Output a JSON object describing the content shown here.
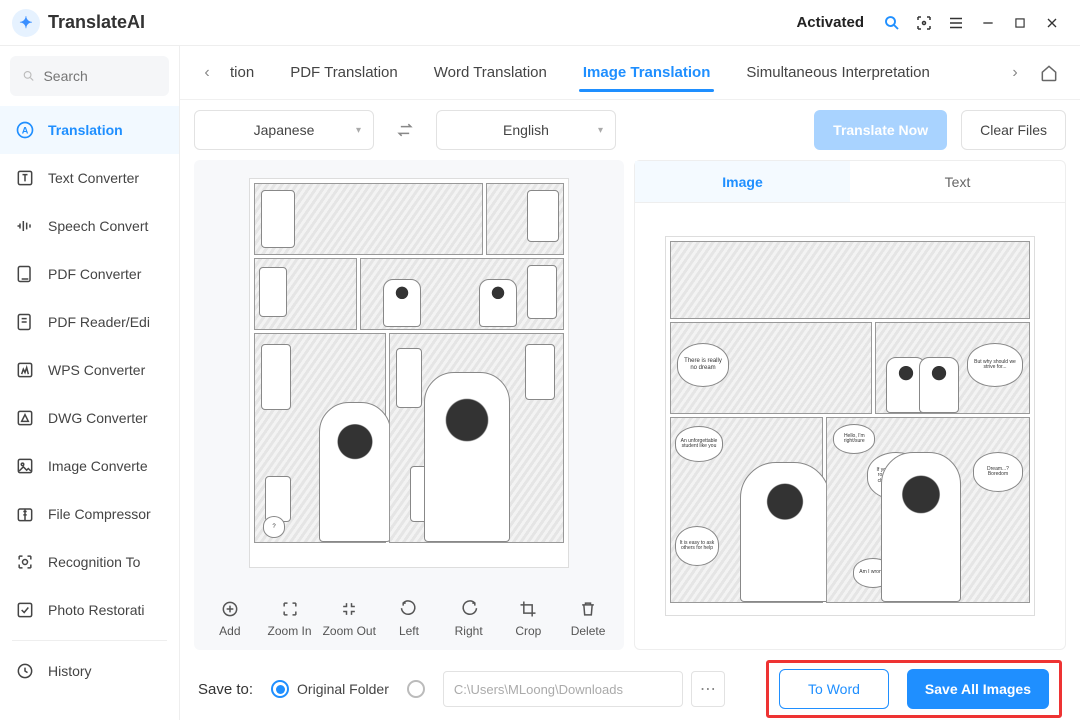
{
  "app": {
    "name": "TranslateAI",
    "status": "Activated"
  },
  "search": {
    "placeholder": "Search"
  },
  "sidebar": {
    "items": [
      {
        "label": "Translation",
        "active": true
      },
      {
        "label": "Text Converter"
      },
      {
        "label": "Speech Convert"
      },
      {
        "label": "PDF Converter"
      },
      {
        "label": "PDF Reader/Edi"
      },
      {
        "label": "WPS Converter"
      },
      {
        "label": "DWG Converter"
      },
      {
        "label": "Image Converte"
      },
      {
        "label": "File Compressor"
      },
      {
        "label": "Recognition To"
      },
      {
        "label": "Photo Restorati"
      }
    ],
    "history_label": "History"
  },
  "tabs": {
    "truncated_first": "tion",
    "items": [
      "PDF Translation",
      "Word Translation",
      "Image Translation",
      "Simultaneous Interpretation"
    ],
    "active_index": 2
  },
  "controls": {
    "source_lang": "Japanese",
    "target_lang": "English",
    "translate_btn": "Translate Now",
    "clear_btn": "Clear Files"
  },
  "left_tools": [
    {
      "key": "add",
      "label": "Add"
    },
    {
      "key": "zoom-in",
      "label": "Zoom In"
    },
    {
      "key": "zoom-out",
      "label": "Zoom Out"
    },
    {
      "key": "left",
      "label": "Left"
    },
    {
      "key": "right",
      "label": "Right"
    },
    {
      "key": "crop",
      "label": "Crop"
    },
    {
      "key": "delete",
      "label": "Delete"
    }
  ],
  "right_tabs": {
    "image": "Image",
    "text": "Text",
    "active": "image"
  },
  "translated_bubbles": {
    "b1": "There is really no dream",
    "b2": "But why should we strive for...",
    "b3": "An unforgettable student like you",
    "b4": "Hello, I'm right/sure",
    "b5": "If you have a safe road, you should choose that road",
    "b6": "Dream...? Boredom",
    "b7": "It is easy to ask others for help",
    "b8": "Am I wrong?"
  },
  "footer": {
    "save_to": "Save to:",
    "original_folder": "Original Folder",
    "custom_path": "C:\\Users\\MLoong\\Downloads",
    "to_word": "To Word",
    "save_all": "Save All Images"
  }
}
